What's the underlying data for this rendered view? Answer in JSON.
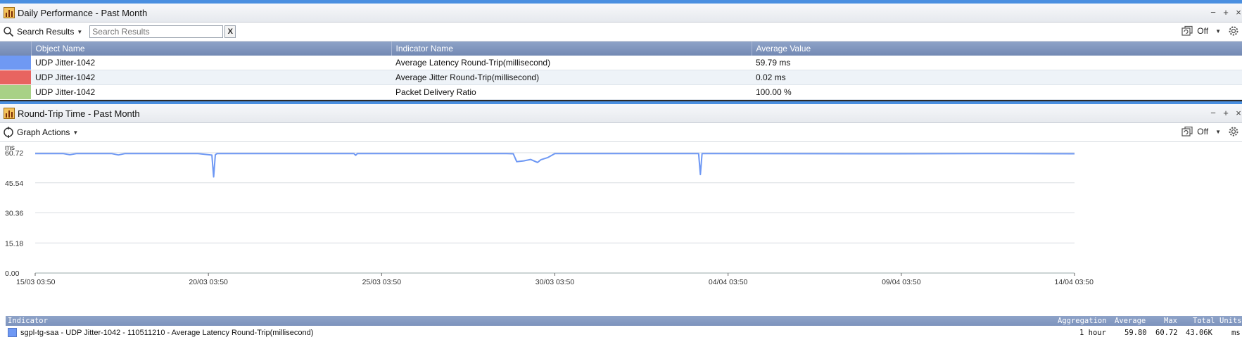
{
  "panel1": {
    "title": "Daily Performance - Past Month",
    "search_label": "Search Results",
    "search_placeholder": "Search Results",
    "clear_label": "X",
    "refresh_state": "Off",
    "controls": {
      "minimize": "−",
      "add": "+",
      "close": "×"
    },
    "table": {
      "columns": [
        "Object Name",
        "Indicator Name",
        "Average Value"
      ],
      "rows": [
        {
          "color": "#6f99f3",
          "object": "UDP Jitter-1042",
          "indicator": "Average Latency Round-Trip(millisecond)",
          "value": "59.79 ms"
        },
        {
          "color": "#e86460",
          "object": "UDP Jitter-1042",
          "indicator": "Average Jitter Round-Trip(millisecond)",
          "value": "0.02 ms"
        },
        {
          "color": "#a8d186",
          "object": "UDP Jitter-1042",
          "indicator": "Packet Delivery Ratio",
          "value": "100.00 %"
        }
      ]
    }
  },
  "panel2": {
    "title": "Round-Trip Time - Past Month",
    "graph_actions_label": "Graph Actions",
    "refresh_state": "Off",
    "controls": {
      "minimize": "−",
      "add": "+",
      "close": "×"
    }
  },
  "chart_data": {
    "type": "line",
    "ylabel": "ms",
    "ylim": [
      0,
      60.72
    ],
    "yticks": [
      "0.00",
      "15.18",
      "30.36",
      "45.54",
      "60.72"
    ],
    "xticks": [
      "15/03 03:50",
      "20/03 03:50",
      "25/03 03:50",
      "30/03 03:50",
      "04/04 03:50",
      "09/04 03:50",
      "14/04 03:50"
    ],
    "series_color": "#6e98f4",
    "series": [
      {
        "x_days": [
          0,
          0.8,
          1.0,
          1.2,
          2.2,
          2.4,
          2.6,
          4.7,
          5.1,
          5.15,
          5.2,
          5.25,
          5.55,
          9.2,
          9.25,
          9.3,
          13.6,
          13.8,
          13.9,
          14.1,
          14.3,
          14.5,
          14.6,
          14.8,
          15.0,
          15.2,
          19.15,
          19.2,
          19.25,
          19.5,
          24.0,
          28.0,
          30.0
        ],
        "values": [
          60.3,
          60.3,
          59.7,
          60.3,
          60.3,
          59.6,
          60.3,
          60.3,
          59.5,
          48.5,
          59.7,
          60.3,
          60.3,
          60.3,
          59.4,
          60.3,
          60.3,
          60.2,
          56.2,
          56.6,
          57.3,
          55.8,
          57.2,
          58.3,
          60.3,
          60.3,
          60.3,
          49.7,
          60.3,
          60.3,
          60.2,
          60.3,
          60.2
        ]
      }
    ],
    "legend": {
      "headers": {
        "indicator": "Indicator",
        "aggregation": "Aggregation",
        "average": "Average",
        "max": "Max",
        "total": "Total",
        "units": "Units"
      },
      "row": {
        "indicator": "sgpl-tg-saa - UDP Jitter-1042 - 110511210 - Average Latency Round-Trip(millisecond)",
        "aggregation": "1 hour",
        "average": "59.80",
        "max": "60.72",
        "total": "43.06K",
        "units": "ms"
      }
    }
  }
}
